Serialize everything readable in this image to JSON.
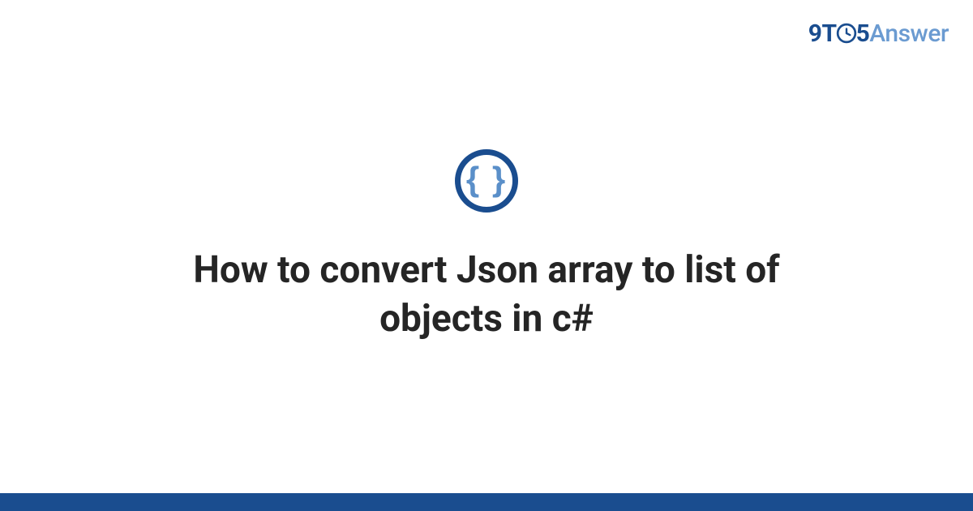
{
  "logo": {
    "nine": "9",
    "t": "T",
    "five": "5",
    "answer": "Answer"
  },
  "icon": {
    "name": "braces-icon",
    "glyph": "{ }"
  },
  "title": "How to convert Json array to list of objects in c#",
  "colors": {
    "primary": "#1a4d8f",
    "secondary": "#5a8fc9",
    "logoLight": "#6b9bd1",
    "text": "#252525"
  }
}
